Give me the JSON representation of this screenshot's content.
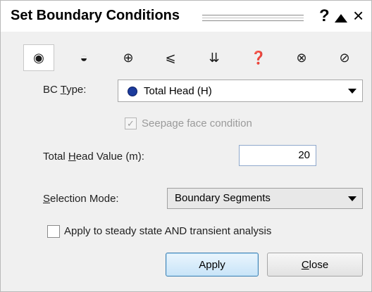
{
  "title": "Set Boundary Conditions",
  "title_buttons": {
    "help": "?",
    "collapse": "collapse-arrow",
    "close": "×"
  },
  "bc_icons": [
    {
      "name": "total-head-icon",
      "glyph": "◉",
      "selected": true
    },
    {
      "name": "pressure-head-icon",
      "glyph": "◒"
    },
    {
      "name": "flow-point-icon",
      "glyph": "⊕"
    },
    {
      "name": "infiltration-icon",
      "glyph": "⩽"
    },
    {
      "name": "unit-flux-icon",
      "glyph": "⇊"
    },
    {
      "name": "unknown-bc-icon",
      "glyph": "❓"
    },
    {
      "name": "zero-flux-icon",
      "glyph": "⊗"
    },
    {
      "name": "remove-bc-icon",
      "glyph": "⊘"
    }
  ],
  "bc_type": {
    "label_pre": "BC ",
    "label_ul": "T",
    "label_post": "ype:",
    "value": "Total Head (H)"
  },
  "seepage": {
    "label": "Seepage face condition",
    "checked": true,
    "disabled": true
  },
  "head_value": {
    "label_pre": "Total ",
    "label_ul": "H",
    "label_post": "ead Value (m):",
    "value": "20"
  },
  "selection_mode": {
    "label_ul": "S",
    "label_post": "election Mode:",
    "value": "Boundary Segments"
  },
  "apply_all": {
    "label": "Apply to steady state AND transient analysis",
    "checked": false
  },
  "buttons": {
    "apply": "Apply",
    "close_ul": "C",
    "close_post": "lose"
  }
}
